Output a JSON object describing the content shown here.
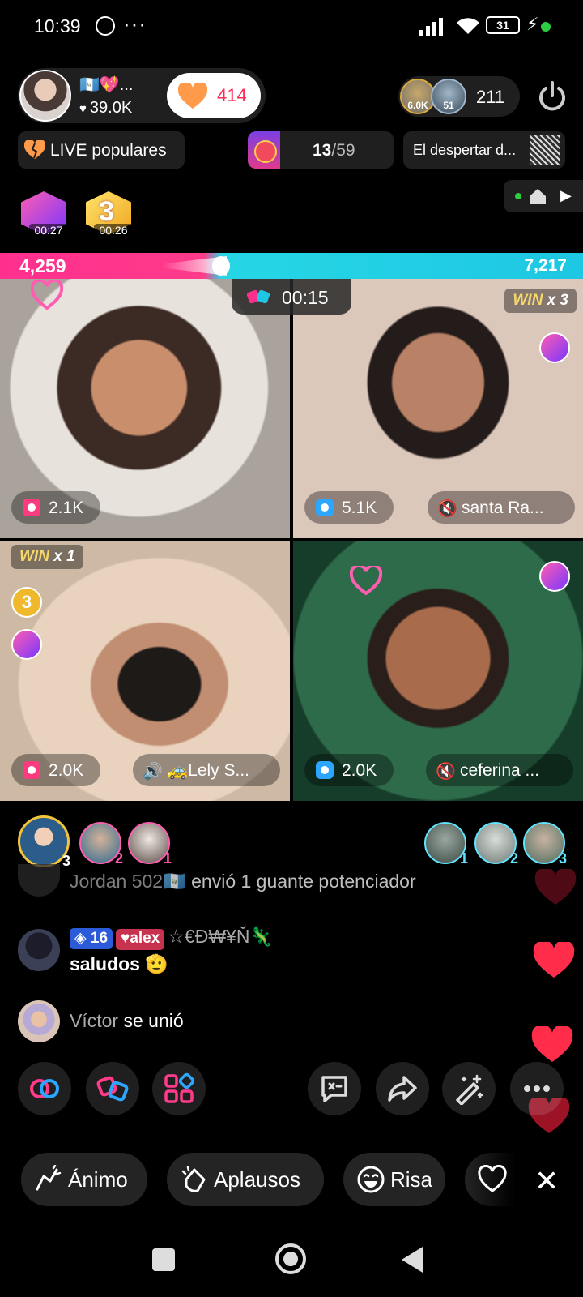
{
  "status_bar": {
    "time": "10:39",
    "more": "···",
    "battery": "31"
  },
  "host": {
    "flag_emojis": "🇬🇹💖...",
    "likes": "39.0K",
    "follow_count": "414"
  },
  "viewers": {
    "badge1": "6.0K",
    "badge2": "51",
    "count": "211"
  },
  "chips": {
    "popular": "LIVE populares",
    "rank_current": "13",
    "rank_total": "/59",
    "song": "El despertar d..."
  },
  "boosts": [
    {
      "timer": "00:27"
    },
    {
      "timer": "00:26"
    }
  ],
  "battle": {
    "left_score": "4,259",
    "right_score": "7,217",
    "timer": "00:15"
  },
  "tiles": [
    {
      "score": "2.1K",
      "name": ""
    },
    {
      "score": "5.1K",
      "name": "santa Ra...",
      "win_label": "WIN",
      "win_mult": "x 3"
    },
    {
      "score": "2.0K",
      "name": "🚕Lely S...",
      "win_label": "WIN",
      "win_mult": "x 1",
      "badge_num": "3"
    },
    {
      "score": "2.0K",
      "name": "ceferina ..."
    }
  ],
  "supporters_left": [
    {
      "rank": "3"
    },
    {
      "rank": "2"
    },
    {
      "rank": "1"
    }
  ],
  "supporters_right": [
    {
      "rank": "1"
    },
    {
      "rank": "2"
    },
    {
      "rank": "3"
    }
  ],
  "chat": [
    {
      "user": "Jordan 502🇬🇹",
      "text": " envió 1 guante potenciador"
    },
    {
      "level": "16",
      "team": "alex",
      "user": "☆€Ɖ₩¥Ň🦎",
      "text": "saludos 🫡"
    },
    {
      "user": "Víctor",
      "text": " se unió"
    }
  ],
  "quick_reactions": [
    {
      "label": "Ánimo"
    },
    {
      "label": "Aplausos"
    },
    {
      "label": "Risa"
    }
  ],
  "colors": {
    "pink": "#fe2c55",
    "cyan": "#1ec7e3",
    "battle_pink": "#ff2f8e"
  }
}
